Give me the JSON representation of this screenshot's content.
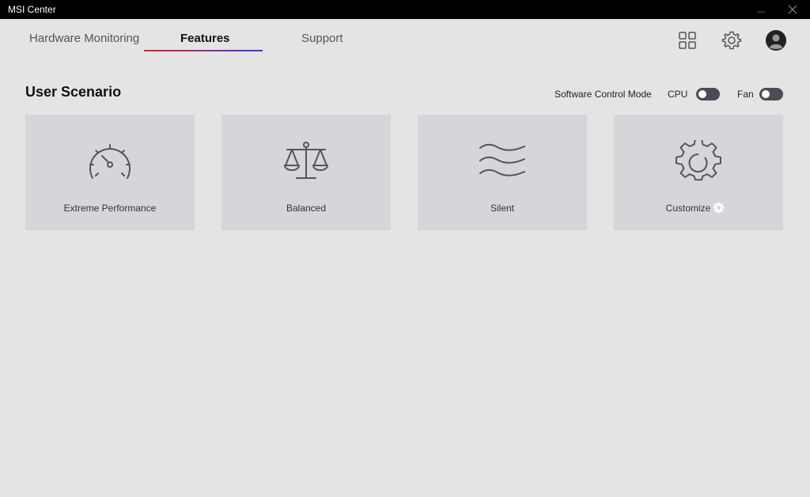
{
  "window": {
    "title": "MSI Center"
  },
  "tabs": [
    {
      "label": "Hardware Monitoring"
    },
    {
      "label": "Features",
      "active": true
    },
    {
      "label": "Support"
    }
  ],
  "header_icons": [
    "grid-icon",
    "settings-gear-icon",
    "user-avatar-icon"
  ],
  "section": {
    "title": "User Scenario",
    "software_control_mode_label": "Software Control Mode",
    "cpu_label": "CPU",
    "fan_label": "Fan",
    "cpu_toggle_on": false,
    "fan_toggle_on": false
  },
  "scenarios": [
    {
      "label": "Extreme Performance",
      "icon": "speedometer-icon"
    },
    {
      "label": "Balanced",
      "icon": "balance-scale-icon"
    },
    {
      "label": "Silent",
      "icon": "waves-icon"
    },
    {
      "label": "Customize",
      "icon": "gear-icon"
    }
  ],
  "colors": {
    "tab_underline_start": "#e0242e",
    "tab_underline_end": "#3a3ae0",
    "toggle_off": "#4a4d55",
    "card_bg": "#d5d6d9"
  }
}
